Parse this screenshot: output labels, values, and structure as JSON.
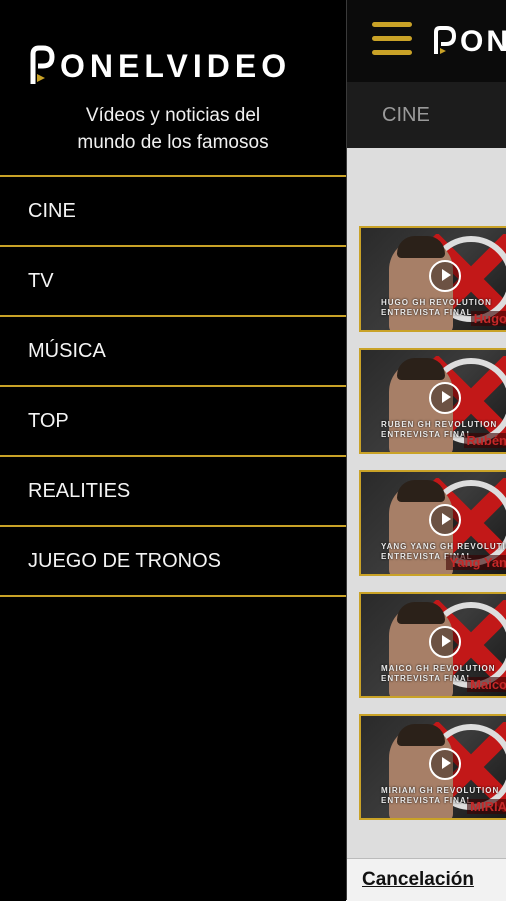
{
  "app": {
    "logo_text": "ONELVIDEO",
    "logo_text_partial": "ON",
    "tabs": [
      {
        "label": "CINE"
      }
    ],
    "bottom_link": "Cancelación",
    "videos": [
      {
        "caption1": "HUGO GH REVOLUTION",
        "caption2": "ENTREVISTA FINAL",
        "name": "Hugo"
      },
      {
        "caption1": "RUBEN GH REVOLUTION",
        "caption2": "ENTREVISTA FINAL",
        "name": "Rubén"
      },
      {
        "caption1": "YANG YANG GH REVOLUTION",
        "caption2": "ENTREVISTA FINAL",
        "name": "Yang Yan"
      },
      {
        "caption1": "MAICO GH REVOLUTION",
        "caption2": "ENTREVISTA FINAL",
        "name": "Maico"
      },
      {
        "caption1": "MIRIAM GH REVOLUTION",
        "caption2": "ENTREVISTA FINAL",
        "name": "MIRIA"
      }
    ]
  },
  "drawer": {
    "logo_text": "ONELVIDEO",
    "tagline_line1": "Vídeos y noticias del",
    "tagline_line2": "mundo de los famosos",
    "menu": [
      {
        "label": "CINE"
      },
      {
        "label": "TV"
      },
      {
        "label": "MÚSICA"
      },
      {
        "label": "TOP"
      },
      {
        "label": "REALITIES"
      },
      {
        "label": "JUEGO DE TRONOS"
      }
    ]
  },
  "colors": {
    "accent": "#c9a227",
    "background": "#000000",
    "text": "#f4f4f4"
  }
}
